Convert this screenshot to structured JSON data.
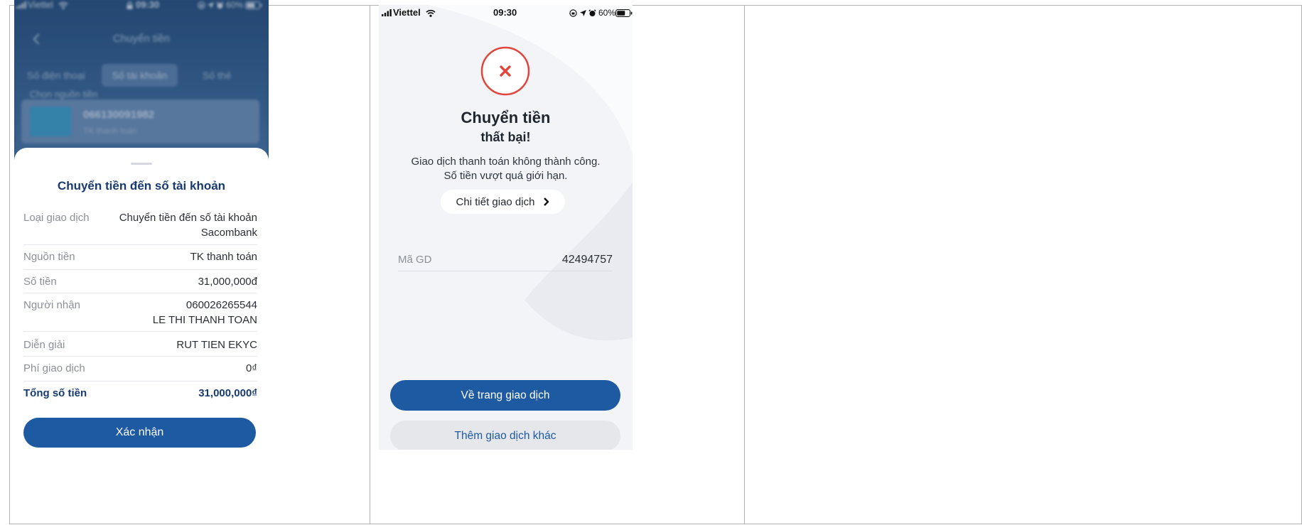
{
  "left_screen": {
    "status_bar": {
      "carrier": "Viettel",
      "time": "09:30",
      "battery": "60%"
    },
    "background_app": {
      "title": "Chuyển tiền",
      "tabs": [
        {
          "label": "Số điện thoại"
        },
        {
          "label": "Số tài khoản",
          "active": true
        },
        {
          "label": "Số thẻ"
        }
      ],
      "source_label": "Chọn nguồn tiền",
      "account_number": "066130091982",
      "account_type": "TK thanh toán"
    },
    "sheet": {
      "title": "Chuyển tiền đến số tài khoản",
      "rows": [
        {
          "label": "Loại giao dịch",
          "value": "Chuyển tiền đến số tài khoản",
          "value_line2": "Sacombank"
        },
        {
          "label": "Nguồn tiền",
          "value": "TK thanh toán"
        },
        {
          "label": "Số tiền",
          "value": "31,000,000đ"
        },
        {
          "label": "Người nhận",
          "value": "060026265544",
          "value_line2": "LE THI THANH TOAN"
        },
        {
          "label": "Diễn giải",
          "value": "RUT TIEN EKYC"
        },
        {
          "label": "Phí giao dịch",
          "value": "0₫"
        }
      ],
      "total": {
        "label": "Tổng số tiền",
        "value": "31,000,000₫"
      },
      "confirm_button": "Xác nhận"
    }
  },
  "middle_screen": {
    "status_bar": {
      "carrier": "Viettel",
      "time": "09:30",
      "battery": "60%"
    },
    "result_icon": "close-icon",
    "title": "Chuyển tiền",
    "subtitle": "thất bại!",
    "message_line1": "Giao dịch thanh toán không thành công.",
    "message_line2": "Số tiền vượt quá giới hạn.",
    "details_link": "Chi tiết giao dịch",
    "transaction_id": {
      "label": "Mã GD",
      "value": "42494757"
    },
    "primary_button": "Về trang giao dịch",
    "secondary_button": "Thêm giao dịch khác"
  },
  "colors": {
    "brand_blue": "#1e5aa2",
    "title_navy": "#173a70",
    "error_red": "#e2453c",
    "label_gray": "#8b9099",
    "secondary_button_bg": "#e6e7ea"
  }
}
